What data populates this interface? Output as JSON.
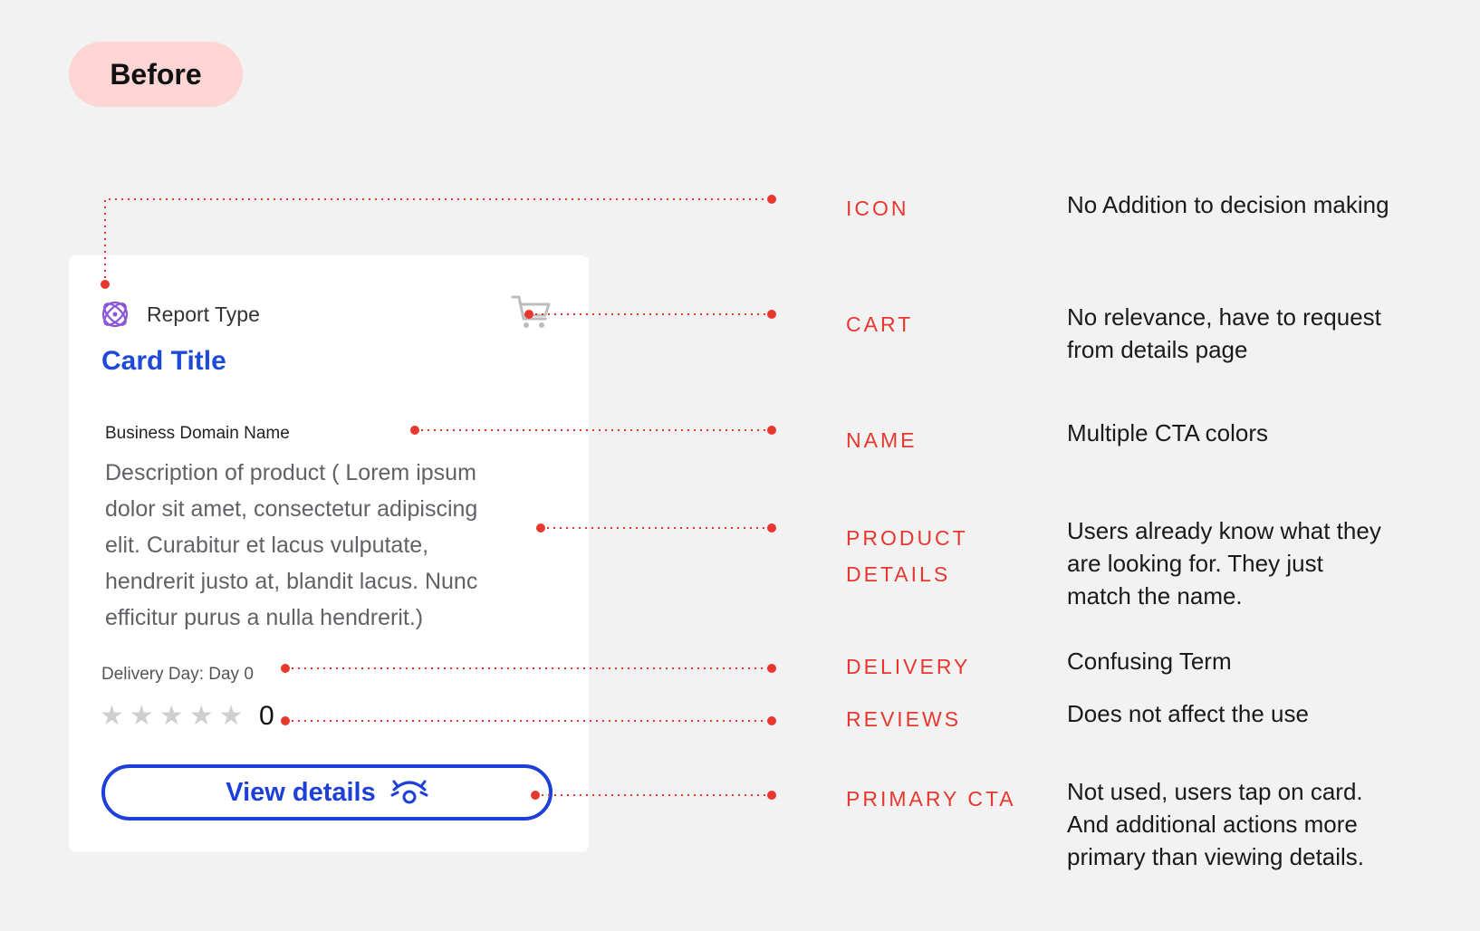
{
  "header": {
    "badge": "Before"
  },
  "card": {
    "report_type_icon": "atom-icon",
    "report_type": "Report Type",
    "cart_icon": "cart-icon",
    "title": "Card Title",
    "domain": "Business Domain Name",
    "description_lines": [
      "Description of product ( Lorem ipsum",
      "dolor sit amet, consectetur adipiscing",
      "elit. Curabitur et lacus vulputate,",
      "hendrerit justo at, blandit lacus. Nunc",
      "efficitur purus a nulla hendrerit.)"
    ],
    "delivery": "Delivery Day: Day 0",
    "rating_stars": 0,
    "rating_max": 5,
    "review_count": "0",
    "cta_label": "View details",
    "cta_icon": "eye-icon"
  },
  "annotations": [
    {
      "label": [
        "ICON"
      ],
      "note": [
        "No Addition to decision making"
      ]
    },
    {
      "label": [
        "CART"
      ],
      "note": [
        "No relevance, have to request",
        "from details page"
      ]
    },
    {
      "label": [
        "NAME"
      ],
      "note": [
        "Multiple CTA colors"
      ]
    },
    {
      "label": [
        "PRODUCT",
        "DETAILS"
      ],
      "note": [
        "Users already know what they",
        "are looking for. They just",
        "match the name."
      ]
    },
    {
      "label": [
        "DELIVERY"
      ],
      "note": [
        "Confusing Term"
      ]
    },
    {
      "label": [
        "REVIEWS"
      ],
      "note": [
        "Does not affect the use"
      ]
    },
    {
      "label": [
        "PRIMARY CTA"
      ],
      "note": [
        "Not used, users tap on card.",
        "And additional actions more",
        "primary than viewing details."
      ]
    }
  ],
  "colors": {
    "accent_red": "#e8372e",
    "brand_blue": "#1e4ad8",
    "badge_bg": "#fdd5d5"
  }
}
